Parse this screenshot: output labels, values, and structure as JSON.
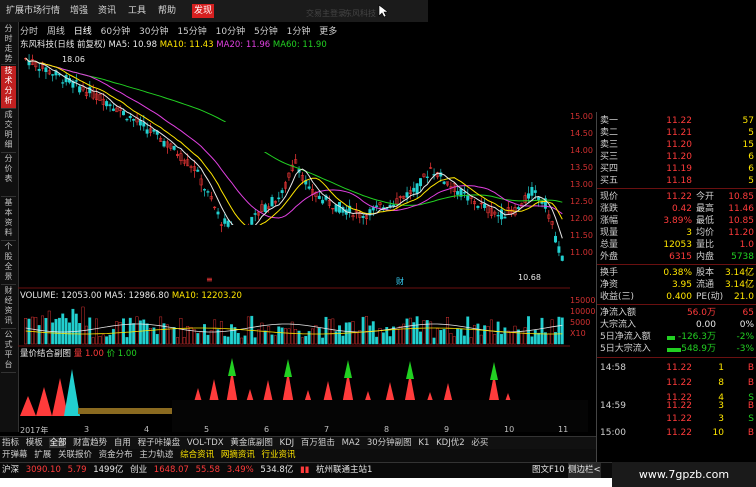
{
  "menubar": {
    "items": [
      "扩展市场行情",
      "增强",
      "资讯",
      "工具",
      "帮助"
    ],
    "highlight": "发现",
    "ghost1": "交易主登录",
    "ghost2": "东风科技"
  },
  "lefttabs": [
    "分时走势",
    "技术分析",
    "成交明细",
    "分价表",
    "基本资料",
    "个股全景",
    "财经资讯",
    "公式平台"
  ],
  "periods": [
    "分时",
    "周线",
    "日线",
    "60分钟",
    "30分钟",
    "15分钟",
    "10分钟",
    "5分钟",
    "1分钟",
    "更多"
  ],
  "legend": {
    "stock": "东风科技(日线 前复权)",
    "ma5": "MA5: 10.98",
    "ma10": "MA10: 11.43",
    "ma20": "MA20: 11.96",
    "ma60": "MA60: 11.90"
  },
  "chart": {
    "high_label": "18.06",
    "low_label": "10.68",
    "price_ticks": [
      "15.00",
      "14.50",
      "14.00",
      "13.50",
      "13.00",
      "12.50",
      "12.00",
      "11.50",
      "11.00"
    ],
    "vol_legend": {
      "vol": "VOLUME: 12053.00",
      "ma5": "MA5: 12986.80",
      "ma10": "MA10: 12203.20"
    },
    "vol_ticks": [
      "15000",
      "10000",
      "5000"
    ],
    "x10": "X10",
    "lower_legend": {
      "name": "量价结合副图",
      "a": "量",
      "a_val": "1.00",
      "b": "价",
      "b_val": "1.00"
    },
    "year": "2017年",
    "months": [
      "3",
      "4",
      "5",
      "6",
      "7",
      "8",
      "9",
      "10",
      "11"
    ]
  },
  "quote": {
    "asks": [
      {
        "l": "卖一",
        "p": "11.22",
        "v": "57"
      },
      {
        "l": "卖二",
        "p": "11.21",
        "v": "5"
      },
      {
        "l": "卖三",
        "p": "11.20",
        "v": "15"
      }
    ],
    "bids": [
      {
        "l": "买三",
        "p": "11.20",
        "v": "6"
      },
      {
        "l": "买四",
        "p": "11.19",
        "v": "6"
      },
      {
        "l": "买五",
        "p": "11.18",
        "v": "5"
      }
    ],
    "stats": [
      {
        "l": "现价",
        "v": "11.22",
        "l2": "今开",
        "v2": "10.85"
      },
      {
        "l": "涨跌",
        "v": "0.42",
        "l2": "最高",
        "v2": "11.46"
      },
      {
        "l": "涨幅",
        "v": "3.89%",
        "l2": "最低",
        "v2": "10.85"
      },
      {
        "l": "现量",
        "v": "3",
        "l2": "均价",
        "v2": "11.20"
      },
      {
        "l": "总量",
        "v": "12053",
        "l2": "量比",
        "v2": "1.0"
      },
      {
        "l": "外盘",
        "v": "6315",
        "l2": "内盘",
        "v2": "5738"
      }
    ],
    "stats2": [
      {
        "l": "换手",
        "v": "0.38%",
        "l2": "股本",
        "v2": "3.14亿"
      },
      {
        "l": "净资",
        "v": "3.95",
        "l2": "流通",
        "v2": "3.14亿"
      },
      {
        "l": "收益(三)",
        "v": "0.400",
        "l2": "PE(动)",
        "v2": "21.0"
      }
    ],
    "flows": [
      {
        "l": "净流入额",
        "v": "56.0万",
        "p": "65"
      },
      {
        "l": "大宗流入",
        "v": "0.00",
        "p": "0%"
      },
      {
        "l": "5日净流入额",
        "v": "-126.3万",
        "p": "-2%"
      },
      {
        "l": "5日大宗流入",
        "v": "-548.9万",
        "p": "-3%"
      }
    ],
    "ticks": [
      {
        "t": "14:58",
        "p": "11.22",
        "v": "1",
        "s": "B"
      },
      {
        "t": "",
        "p": "11.22",
        "v": "8",
        "s": "B"
      },
      {
        "t": "",
        "p": "11.22",
        "v": "4",
        "s": "S"
      },
      {
        "t": "14:59",
        "p": "11.22",
        "v": "3",
        "s": "B"
      },
      {
        "t": "",
        "p": "11.22",
        "v": "3",
        "s": "S"
      },
      {
        "t": "15:00",
        "p": "11.22",
        "v": "10",
        "s": "B"
      }
    ]
  },
  "bottomtabs": [
    "指标",
    "模板",
    "全部",
    "财富趋势",
    "自用",
    "程子咔操盘",
    "VOL-TDX",
    "黄金底副图",
    "KDJ",
    "百万狙击",
    "MA2",
    "30分钟副图",
    "K1",
    "KDJ优2",
    "必买"
  ],
  "funcbar": [
    "开弹幕",
    "扩展",
    "关联报价",
    "资金分布",
    "主力轨迹",
    "综合资讯",
    "网摘资讯",
    "行业资讯"
  ],
  "status": {
    "sh_name": "沪深",
    "sh_val": "3090.10",
    "sh_chg": "5.79",
    "sh_amt": "1499亿",
    "cy_name": "创业",
    "cy_val": "1648.07",
    "cy_chg": "55.58",
    "cy_pct": "3.49%",
    "cy_amt": "534.8亿",
    "conn": "杭州联通主站1",
    "f10": "图文F10",
    "tip": "侧边栏<"
  },
  "watermark": "www.7gpzb.com",
  "colors": {
    "up": "#ff3b3b",
    "down": "#22d022",
    "ma5": "#e8e8e8",
    "ma10": "#ffe600",
    "ma20": "#e040e0",
    "ma60": "#22d022"
  }
}
